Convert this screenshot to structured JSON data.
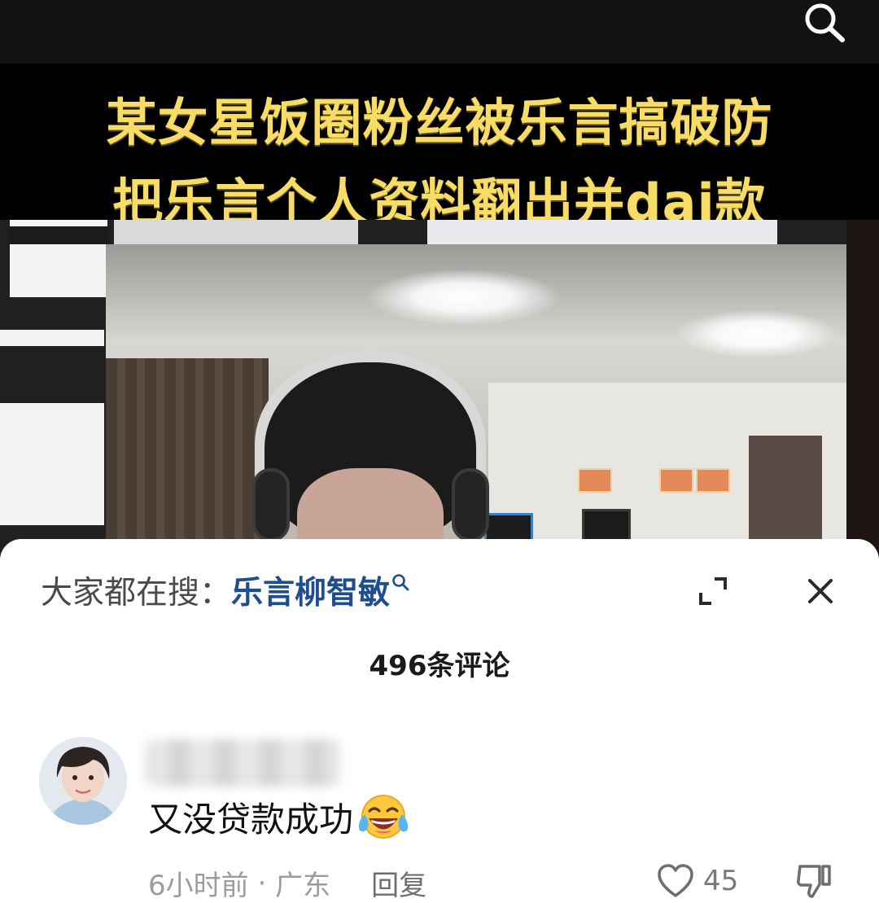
{
  "video": {
    "caption_line_1": "某女星饭圈粉丝被乐言搞破防",
    "caption_line_2": "把乐言个人资料翻出并dai款"
  },
  "icons": {
    "top_search": "search-icon",
    "suggestion_search": "search-icon",
    "expand": "expand-icon",
    "close": "close-icon",
    "like": "heart-icon",
    "dislike": "thumbs-down-icon",
    "emoji": "face-with-tears-of-joy-emoji"
  },
  "search_suggestion": {
    "prefix": "大家都在搜：",
    "term": "乐言柳智敏"
  },
  "comments_header": {
    "count_label": "496条评论"
  },
  "comment": {
    "username": "",
    "text": "又没贷款成功",
    "time": "6小时前",
    "separator": " · ",
    "location": "广东",
    "reply_label": "回复",
    "like_count": "45"
  },
  "colors": {
    "caption_yellow": "#f7dc67",
    "suggestion_blue": "#1f4e8c",
    "meta_gray": "#9c9c9c",
    "sheet_bg": "#ffffff"
  }
}
